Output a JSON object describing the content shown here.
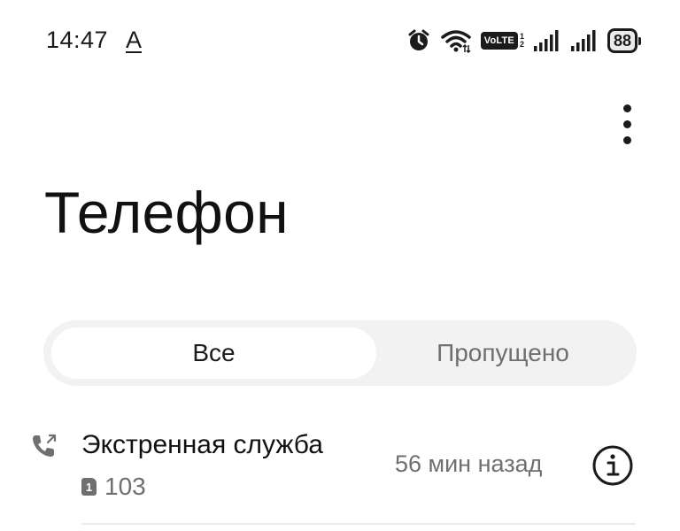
{
  "status_bar": {
    "time": "14:47",
    "time_suffix": "A",
    "volte": "VoLTE",
    "volte_sim_top": "1",
    "volte_sim_bottom": "2",
    "battery": "88",
    "icons": [
      "alarm-icon",
      "wifi-icon",
      "volte-icon",
      "signal-sim1-icon",
      "signal-sim2-icon",
      "battery-icon"
    ]
  },
  "header": {
    "title": "Телефон",
    "more_icon": "more-vertical-icon"
  },
  "tabs": [
    {
      "label": "Все",
      "selected": true
    },
    {
      "label": "Пропущено",
      "selected": false
    }
  ],
  "call_log": [
    {
      "name": "Экстренная служба",
      "sim": "1",
      "number": "103",
      "time": "56 мин назад",
      "type_icon": "outgoing-call-icon",
      "action_icon": "info-icon"
    }
  ],
  "colors": {
    "text_primary": "#1b1b1b",
    "text_secondary": "#6f6f6f",
    "tab_track": "#f2f2f2",
    "tab_selected": "#ffffff"
  }
}
